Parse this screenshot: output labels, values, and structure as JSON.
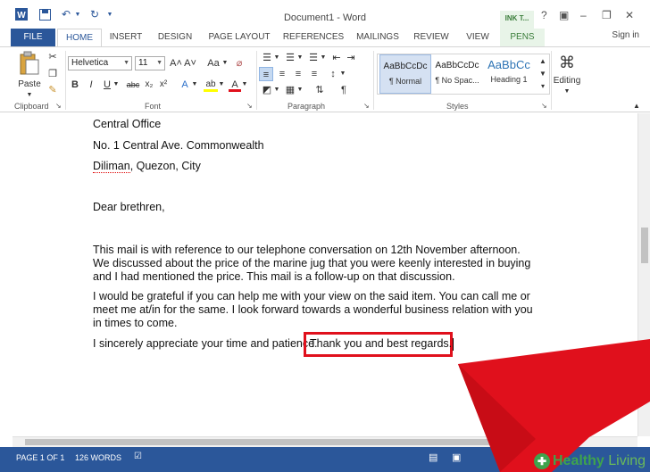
{
  "titlebar": {
    "title": "Document1 - Word",
    "ink_tab_header": "INK T...",
    "help": "?",
    "minimize": "–",
    "restore": "❐",
    "close": "✕"
  },
  "tabs": {
    "file": "FILE",
    "home": "HOME",
    "insert": "INSERT",
    "design": "DESIGN",
    "page_layout": "PAGE LAYOUT",
    "references": "REFERENCES",
    "mailings": "MAILINGS",
    "review": "REVIEW",
    "view": "VIEW",
    "pens": "PENS",
    "sign_in": "Sign in"
  },
  "ribbon": {
    "clipboard": {
      "paste_label": "Paste",
      "group_label": "Clipboard"
    },
    "font": {
      "font_name": "Helvetica",
      "font_size": "11",
      "bold": "B",
      "italic": "I",
      "underline": "U",
      "strikethrough": "abc",
      "subscript": "x₂",
      "superscript": "x²",
      "grow": "A˄",
      "shrink": "A˅",
      "change_case": "Aa",
      "text_effects": "A",
      "highlight": "ab",
      "font_color": "A",
      "group_label": "Font"
    },
    "paragraph": {
      "pilcrow": "¶",
      "group_label": "Paragraph"
    },
    "styles": {
      "items": [
        {
          "sample": "AaBbCcDc",
          "name": "¶ Normal"
        },
        {
          "sample": "AaBbCcDc",
          "name": "¶ No Spac..."
        },
        {
          "sample": "AaBbCc",
          "name": "Heading 1"
        }
      ],
      "group_label": "Styles"
    },
    "editing": {
      "label": "Editing"
    }
  },
  "document": {
    "address_line1": "Central Office",
    "address_line2": "No. 1 Central Ave. Commonwealth",
    "address_line3_underlined": "Diliman",
    "address_line3_rest": ", Quezon, City",
    "salutation": "Dear brethren,",
    "para1": "This mail is with reference to our telephone conversation on 12th November afternoon. We discussed about the price of the marine jug that you were keenly interested in buying and I had mentioned the price. This mail is a follow-up on that discussion.",
    "para2": "I would be grateful if you can help me with your view on the said item. You can call me or meet me at/in for the same. I look forward towards a wonderful business relation with you in times to come.",
    "para3": "I sincerely appreciate your time and patience.",
    "highlighted": "Thank you and best regards."
  },
  "statusbar": {
    "page": "PAGE 1 OF 1",
    "words": "126 WORDS"
  },
  "watermark": {
    "brand_a": "Healthy",
    "brand_b": " Living"
  },
  "colors": {
    "accent": "#2b579a",
    "highlight_box": "#e0101c",
    "arrow": "#e0101c",
    "pens_tab": "#3a7d3a"
  }
}
